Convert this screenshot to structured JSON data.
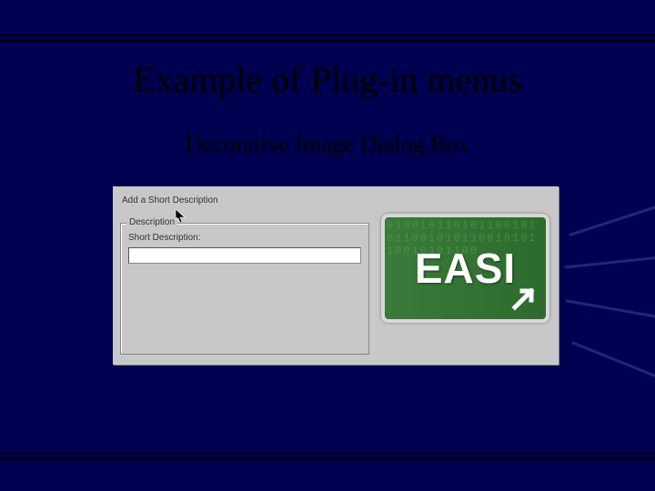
{
  "slide": {
    "title": "Example of Plug-in menus",
    "subtitle": "Decorative Image Dialog Box"
  },
  "dialog": {
    "header": "Add a Short Description",
    "group_label": "Description",
    "field_label": "Short Description:",
    "input_value": ""
  },
  "logo": {
    "text": "EASI",
    "binary_bg": "01001011010110010101100101011001010110010101100"
  }
}
